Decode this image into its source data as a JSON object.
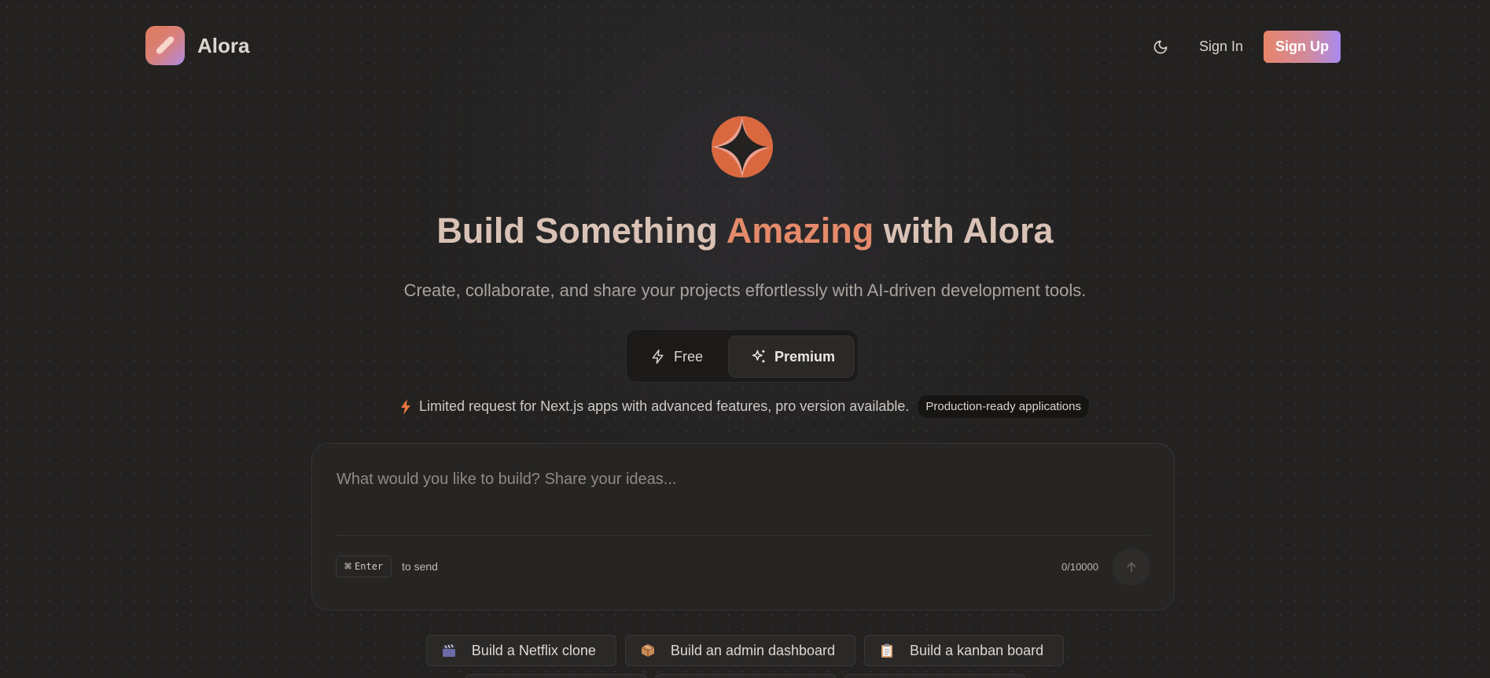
{
  "header": {
    "brand": "Alora",
    "theme_toggle_icon": "moon-icon",
    "sign_in": "Sign In",
    "sign_up": "Sign Up"
  },
  "hero": {
    "title_part1": "Build Something",
    "title_part2": "Amazing",
    "title_part3": "with Alora",
    "subtitle": "Create, collaborate, and share your projects effortlessly with AI-driven development tools."
  },
  "plans": {
    "free_label": "Free",
    "premium_label": "Premium",
    "selected": "Premium"
  },
  "notice": {
    "text": "Limited request for Next.js apps with advanced features, pro version available.",
    "badge": "Production-ready applications"
  },
  "prompt": {
    "placeholder": "What would you like to build? Share your ideas...",
    "value": "",
    "shortcut_key": "Enter",
    "shortcut_symbol": "⌘",
    "shortcut_hint": "to send",
    "counter": "0/10000"
  },
  "suggestions": [
    {
      "label": "Build a Netflix clone",
      "icon": "clapper-board-icon"
    },
    {
      "label": "Build an admin dashboard",
      "icon": "package-icon"
    },
    {
      "label": "Build a kanban board",
      "icon": "clipboard-icon"
    }
  ],
  "colors": {
    "background": "#232221",
    "accent": "#e48a6a",
    "accent_purple": "#aa8af0"
  }
}
